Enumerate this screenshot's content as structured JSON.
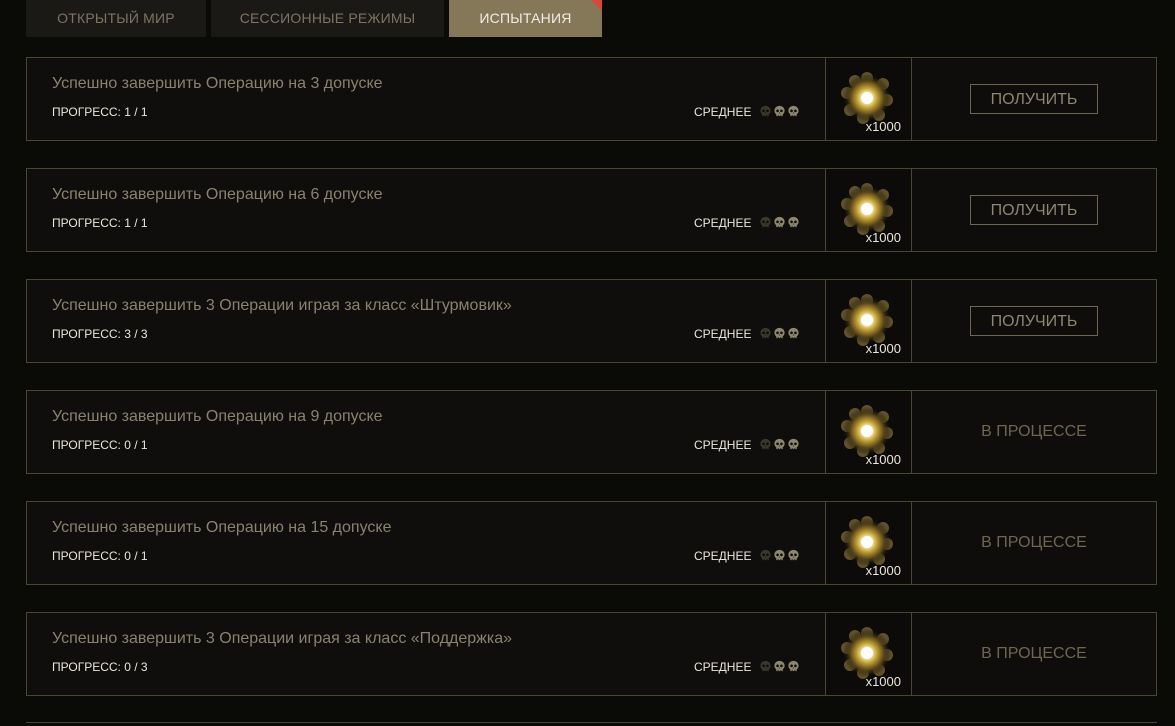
{
  "tabs": [
    {
      "label": "ОТКРЫТЫЙ МИР",
      "active": false
    },
    {
      "label": "СЕССИОННЫЕ РЕЖИМЫ",
      "active": false
    },
    {
      "label": "ИСПЫТАНИЯ",
      "active": true
    }
  ],
  "challenges": [
    {
      "title": "Успешно завершить Операцию на 3 допуске",
      "progress": "ПРОГРЕСС: 1 / 1",
      "difficulty": "СРЕДНЕЕ",
      "difficulty_level": 2,
      "reward_qty": "x1000",
      "action_type": "button",
      "action_label": "ПОЛУЧИТЬ"
    },
    {
      "title": "Успешно завершить Операцию на 6 допуске",
      "progress": "ПРОГРЕСС: 1 / 1",
      "difficulty": "СРЕДНЕЕ",
      "difficulty_level": 2,
      "reward_qty": "x1000",
      "action_type": "button",
      "action_label": "ПОЛУЧИТЬ"
    },
    {
      "title": "Успешно завершить 3 Операции играя за класс «Штурмовик»",
      "progress": "ПРОГРЕСС: 3 / 3",
      "difficulty": "СРЕДНЕЕ",
      "difficulty_level": 2,
      "reward_qty": "x1000",
      "action_type": "button",
      "action_label": "ПОЛУЧИТЬ"
    },
    {
      "title": "Успешно завершить Операцию на 9 допуске",
      "progress": "ПРОГРЕСС: 0 / 1",
      "difficulty": "СРЕДНЕЕ",
      "difficulty_level": 2,
      "reward_qty": "x1000",
      "action_type": "status",
      "action_label": "В ПРОЦЕССЕ"
    },
    {
      "title": "Успешно завершить Операцию на 15 допуске",
      "progress": "ПРОГРЕСС: 0 / 1",
      "difficulty": "СРЕДНЕЕ",
      "difficulty_level": 2,
      "reward_qty": "x1000",
      "action_type": "status",
      "action_label": "В ПРОЦЕССЕ"
    },
    {
      "title": "Успешно завершить 3 Операции играя за класс «Поддержка»",
      "progress": "ПРОГРЕСС: 0 / 3",
      "difficulty": "СРЕДНЕЕ",
      "difficulty_level": 2,
      "reward_qty": "x1000",
      "action_type": "status",
      "action_label": "В ПРОЦЕССЕ"
    }
  ],
  "colors": {
    "background": "#0a0a07",
    "card_border": "#4b4633",
    "active_tab": "#857859",
    "title_text": "#8a826f",
    "status_text": "#6e6650",
    "skull_filled": "#8d876f",
    "skull_empty": "#3a372c"
  },
  "icons": {
    "reward": "glowing-orb-icon",
    "difficulty": "skull-icon",
    "tab_notification": "red-corner-marker"
  }
}
